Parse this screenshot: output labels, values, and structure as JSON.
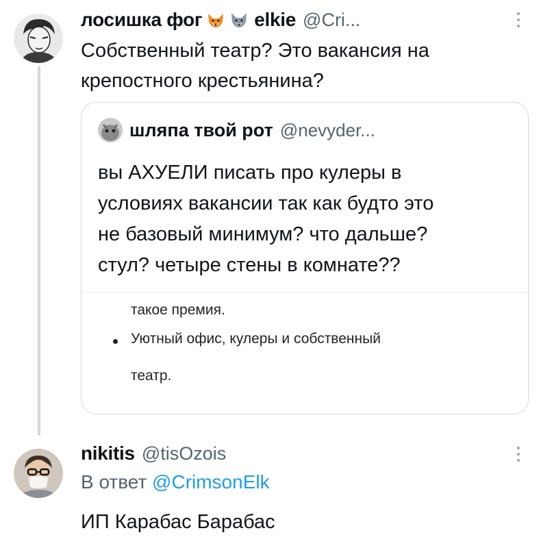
{
  "tweet": {
    "author_name": "лосишка фог",
    "emoji_1": "fox-emoji",
    "emoji_2": "wolf-emoji",
    "author_name_2": "elkie",
    "handle": "@Cri...",
    "text": "Собственный театр? Это вакансия на\nкрепостного крестьянина?"
  },
  "quoted": {
    "author_name": "шляпа твой рот",
    "handle": "@nevyder...",
    "text": "вы АХУЕЛИ писать про кулеры в\nусловиях вакансии так как будто это\nне базовый минимум? что дальше?\nстул? четыре стены в комнате??",
    "image_lines": [
      "такое премия.",
      "Уютный офис, кулеры и собственный",
      "театр."
    ]
  },
  "reply": {
    "author_name": "nikitis",
    "handle": "@tisOzois",
    "reply_prefix": "В ответ ",
    "reply_mention": "@CrimsonElk",
    "text": "ИП Карабас Барабас"
  },
  "colors": {
    "text": "#0f1419",
    "secondary": "#536471",
    "accent": "#1d9bf0",
    "border": "#cfd9de"
  }
}
